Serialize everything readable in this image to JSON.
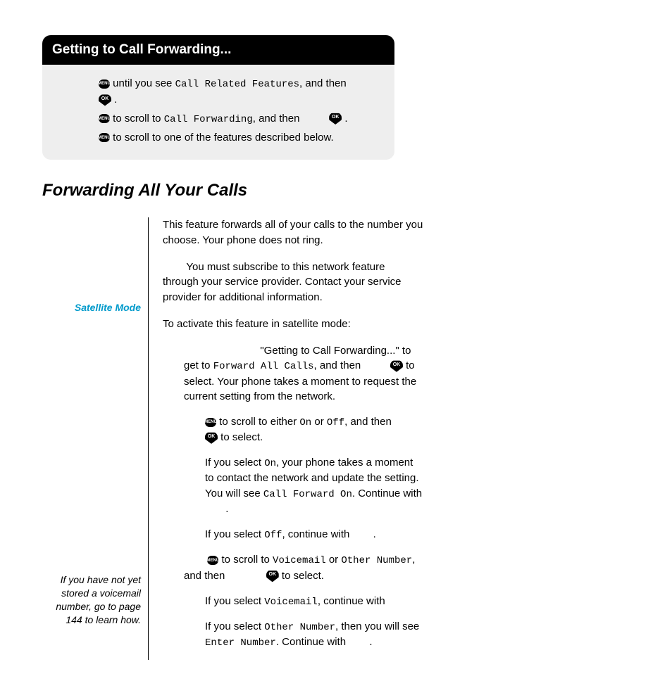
{
  "header": {
    "title": "Getting to Call Forwarding...",
    "step1_a": "until you see",
    "step1_b": "Call Related Features",
    "step1_c": ", and then",
    "step1_d": ".",
    "step2_a": "to scroll to",
    "step2_b": "Call Forwarding",
    "step2_c": ", and then",
    "step2_d": ".",
    "step3": "to scroll to one of the features described below."
  },
  "section": {
    "heading": "Forwarding All Your Calls",
    "intro1": "This feature forwards all of your calls to the number you choose. Your phone does not ring.",
    "intro2": "You must subscribe to this network feature through your service provider. Contact your service provider for additional information.",
    "side_label": "Satellite Mode",
    "sat_intro": "To activate this feature in satellite mode:",
    "s1_a": "\"Getting to Call Forwarding...\" to get to",
    "s1_b": "Forward All Calls",
    "s1_c": ", and then",
    "s1_d": "to select. Your phone takes a moment to request the current setting from the network.",
    "s2_a": "to scroll to either",
    "s2_on": "On",
    "s2_or": "or",
    "s2_off": "Off",
    "s2_b": ", and then",
    "s2_c": "to select.",
    "s2_note_on_a": "If you select",
    "s2_note_on_b": ", your phone takes a moment to contact the network and update the setting. You will see",
    "s2_note_on_c": "Call Forward On",
    "s2_note_on_d": ". Continue with",
    "s2_note_on_e": ".",
    "s2_note_off_a": "If you select",
    "s2_note_off_b": ", continue with",
    "s2_note_off_c": ".",
    "s3_a": "to scroll to",
    "s3_vm": "Voicemail",
    "s3_or": "or",
    "s3_on": "Other Number",
    "s3_b": ", and then",
    "s3_c": "to select.",
    "s3_note_vm_a": "If you select",
    "s3_note_vm_b": ", continue with",
    "s3_note_on_a": "If you select",
    "s3_note_on_b": ", then you will see",
    "s3_note_on_c": "Enter Number",
    "s3_note_on_d": ". Continue with",
    "s3_note_on_e": ".",
    "side_note": "If you have not yet stored a voicemail number, go to page 144 to learn how."
  },
  "icons": {
    "menu": "MENU",
    "ok": "OK"
  }
}
